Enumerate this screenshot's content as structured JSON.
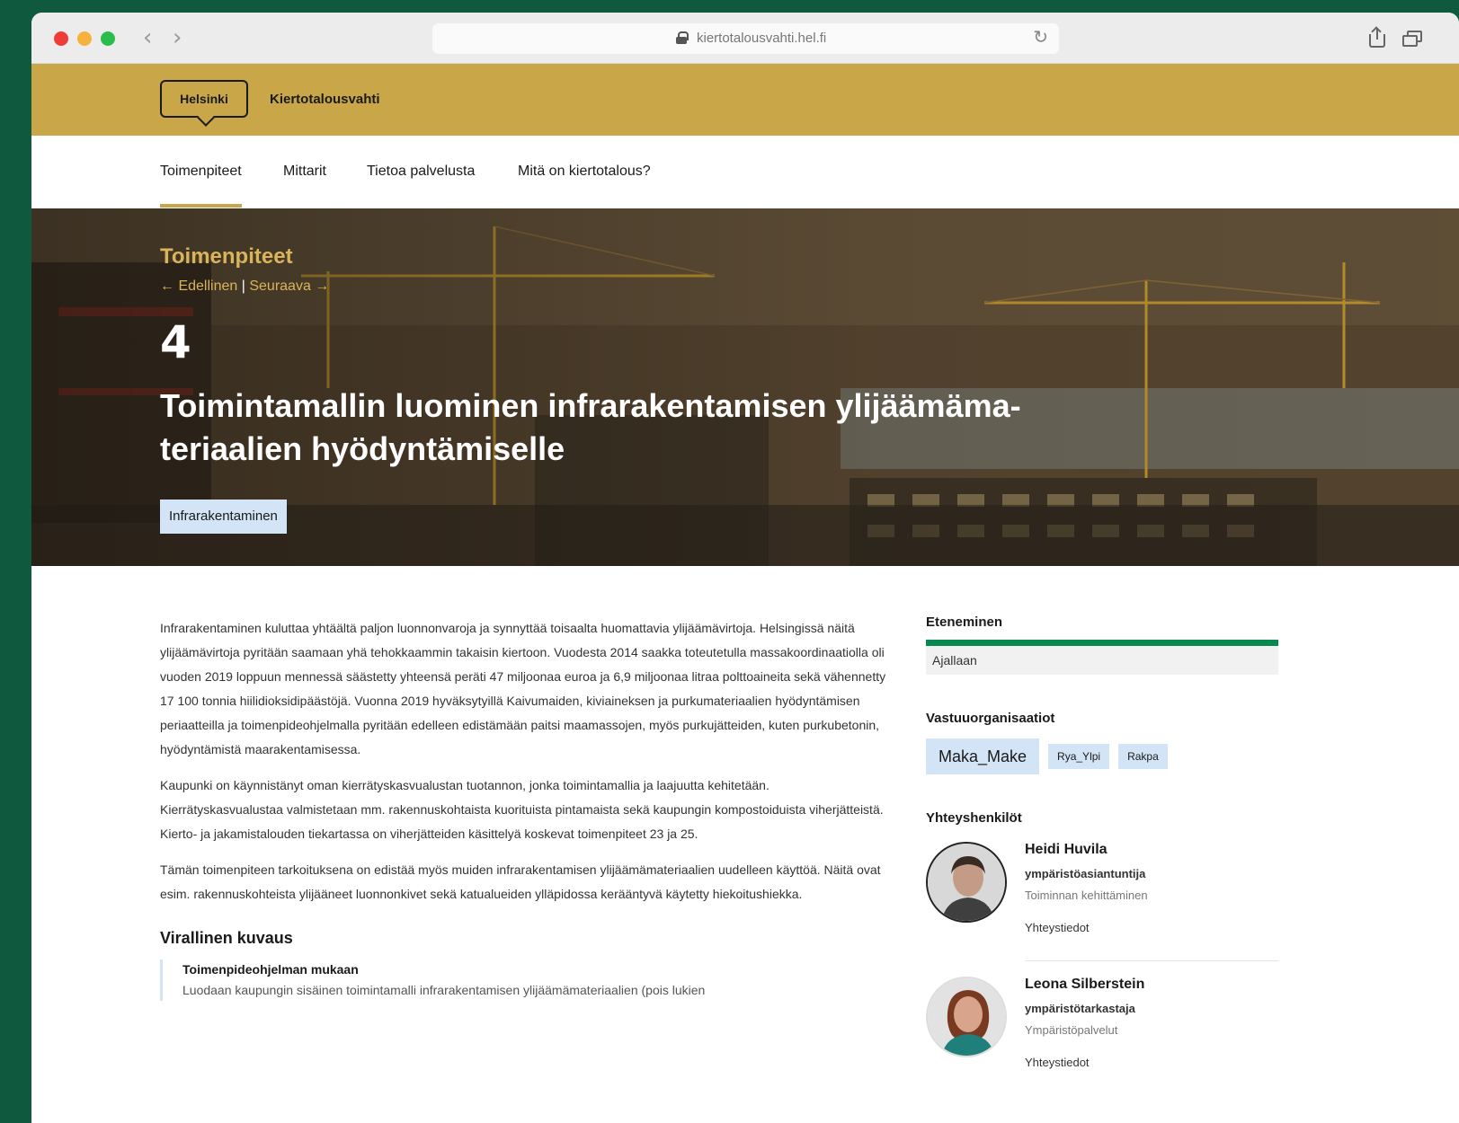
{
  "browser": {
    "url": "kiertotalousvahti.hel.fi"
  },
  "site": {
    "logo": "Helsinki",
    "name": "Kiertotalousvahti"
  },
  "nav": {
    "items": [
      {
        "label": "Toimenpiteet",
        "active": true
      },
      {
        "label": "Mittarit",
        "active": false
      },
      {
        "label": "Tietoa palvelusta",
        "active": false
      },
      {
        "label": "Mitä on kiertotalous?",
        "active": false
      }
    ]
  },
  "hero": {
    "kicker": "Toimenpiteet",
    "prev": "← Edellinen",
    "separator": "|",
    "next": "Seuraava →",
    "number": "4",
    "title": "Toimintamallin luominen infrarakentamisen ylijäämäma- teriaalien hyödyntämiselle",
    "tag": "Infrarakentaminen"
  },
  "article": {
    "paragraphs": [
      "Infrarakentaminen kuluttaa yhtäältä paljon luonnonvaroja ja synnyttää toisaalta huomattavia ylijäämävirtoja. Helsingissä näitä ylijäämävirtoja pyritään saamaan yhä tehokkaammin takaisin kiertoon. Vuodesta 2014 saakka toteutetulla massakoordinaatiolla oli vuoden 2019 loppuun mennessä säästetty yhteensä peräti 47 miljoonaa euroa ja 6,9 miljoonaa litraa polttoaineita sekä vähennetty 17 100 tonnia hiilidioksidipäästöjä. Vuonna 2019 hyväksytyillä Kaivumaiden, kiviaineksen ja purkumateriaalien hyödyntämisen periaatteilla ja toimenpideohjelmalla pyritään edelleen edistämään paitsi maamassojen, myös purkujätteiden, kuten purkubetonin, hyödyntämistä maarakentamisessa.",
      "Kaupunki on käynnistänyt oman kierrätyskasvualustan tuotannon, jonka toimintamallia ja laajuutta kehitetään. Kierrätyskasvualustaa valmistetaan mm. rakennuskohtaista kuorituista pintamaista sekä kaupungin kompostoiduista viherjätteistä. Kierto- ja jakamistalouden tiekartassa on viherjätteiden käsittelyä koskevat toimenpiteet 23 ja 25.",
      "Tämän toimenpiteen tarkoituksena on edistää myös muiden infrarakentamisen ylijäämämateriaalien uudelleen käyttöä. Näitä ovat esim. rakennuskohteista ylijääneet luonnonkivet sekä katualueiden ylläpidossa kerääntyvä käytetty hiekoitushiekka."
    ],
    "official_heading": "Virallinen kuvaus",
    "official_subheading": "Toimenpideohjelman mukaan",
    "official_text": "Luodaan kaupungin sisäinen toimintamalli infrarakentamisen ylijäämämateriaalien (pois lukien"
  },
  "sidebar": {
    "progress_heading": "Eteneminen",
    "progress_value": 1.0,
    "progress_label": "Ajallaan",
    "orgs_heading": "Vastuuorganisaatiot",
    "orgs": [
      "Maka_Make",
      "Rya_Ylpi",
      "Rakpa"
    ],
    "contacts_heading": "Yhteyshenkilöt",
    "contacts": [
      {
        "name": "Heidi Huvila",
        "title": "ympäristöasiantuntija",
        "unit": "Toiminnan kehittäminen",
        "link": "Yhteystiedot"
      },
      {
        "name": "Leona Silberstein",
        "title": "ympäristötarkastaja",
        "unit": "Ympäristöpalvelut",
        "link": "Yhteystiedot"
      }
    ]
  },
  "colors": {
    "page_bg": "#0f5a3f",
    "header_gold": "#c9a648",
    "accent_gold": "#d9b45a",
    "tag_blue": "#d2e4f6",
    "progress_green": "#06884f"
  }
}
